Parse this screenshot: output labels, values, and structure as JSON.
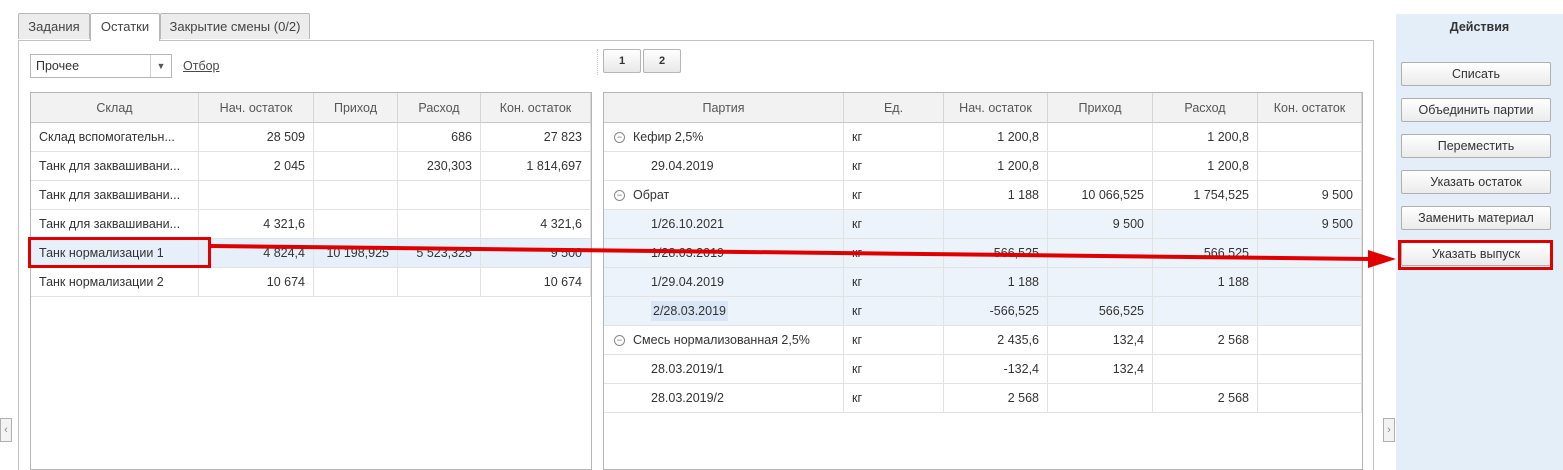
{
  "tabs": [
    {
      "label": "Задания"
    },
    {
      "label": "Остатки"
    },
    {
      "label": "Закрытие смены (0/2)"
    }
  ],
  "filter": {
    "select_value": "Прочее",
    "link": "Отбор"
  },
  "pages": [
    "1",
    "2"
  ],
  "left_table": {
    "headers": [
      "Склад",
      "Нач. остаток",
      "Приход",
      "Расход",
      "Кон. остаток"
    ],
    "rows": [
      [
        "Склад вспомогательн...",
        "28 509",
        "",
        "686",
        "27 823"
      ],
      [
        "Танк для заквашивани...",
        "2 045",
        "",
        "230,303",
        "1 814,697"
      ],
      [
        "Танк для заквашивани...",
        "",
        "",
        "",
        ""
      ],
      [
        "Танк для заквашивани...",
        "4 321,6",
        "",
        "",
        "4 321,6"
      ],
      [
        "Танк нормализации 1",
        "4 824,4",
        "10 198,925",
        "5 523,325",
        "9 500"
      ],
      [
        "Танк нормализации 2",
        "10 674",
        "",
        "",
        "10 674"
      ]
    ]
  },
  "right_table": {
    "headers": [
      "Партия",
      "Ед.",
      "Нач. остаток",
      "Приход",
      "Расход",
      "Кон. остаток"
    ],
    "rows": [
      [
        "Кефир 2,5%",
        "кг",
        "1 200,8",
        "",
        "1 200,8",
        ""
      ],
      [
        "29.04.2019",
        "кг",
        "1 200,8",
        "",
        "1 200,8",
        ""
      ],
      [
        "Обрат",
        "кг",
        "1 188",
        "10 066,525",
        "1 754,525",
        "9 500"
      ],
      [
        "1/26.10.2021",
        "кг",
        "",
        "9 500",
        "",
        "9 500"
      ],
      [
        "1/28.03.2019",
        "кг",
        "-566,525",
        "",
        "566,525",
        ""
      ],
      [
        "1/29.04.2019",
        "кг",
        "1 188",
        "",
        "1 188",
        ""
      ],
      [
        "2/28.03.2019",
        "кг",
        "-566,525",
        "566,525",
        "",
        ""
      ],
      [
        "Смесь нормализованная 2,5%",
        "кг",
        "2 435,6",
        "132,4",
        "2 568",
        ""
      ],
      [
        "28.03.2019/1",
        "кг",
        "-132,4",
        "132,4",
        "",
        ""
      ],
      [
        "28.03.2019/2",
        "кг",
        "2 568",
        "",
        "2 568",
        ""
      ]
    ]
  },
  "actions": {
    "title": "Действия",
    "buttons": [
      "Списать",
      "Объединить партии",
      "Переместить",
      "Указать остаток",
      "Заменить материал",
      "Указать выпуск"
    ]
  },
  "colors": {
    "annotation_red": "#e00000",
    "selected_row": "#e7f0fa",
    "side_panel": "#e4eef8"
  }
}
